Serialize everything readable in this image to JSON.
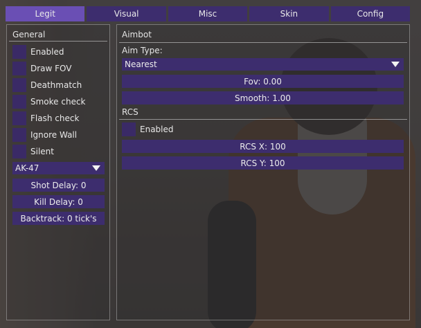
{
  "colors": {
    "tab_active": "#6a4fb4",
    "tab": "#3d2d6e",
    "control": "#3d2d6e",
    "checkbox": "#3a2a66"
  },
  "tabs": [
    {
      "label": "Legit",
      "active": true
    },
    {
      "label": "Visual",
      "active": false
    },
    {
      "label": "Misc",
      "active": false
    },
    {
      "label": "Skin",
      "active": false
    },
    {
      "label": "Config",
      "active": false
    }
  ],
  "general": {
    "title": "General",
    "checkboxes": [
      "Enabled",
      "Draw FOV",
      "Deathmatch",
      "Smoke check",
      "Flash check",
      "Ignore Wall",
      "Silent"
    ],
    "weapon_select": "AK-47",
    "shot_delay": "Shot Delay: 0",
    "kill_delay": "Kill Delay: 0",
    "backtrack": "Backtrack: 0 tick's"
  },
  "aimbot": {
    "title": "Aimbot",
    "aim_type_label": "Aim Type:",
    "aim_type_value": "Nearest",
    "fov": "Fov: 0.00",
    "smooth": "Smooth: 1.00"
  },
  "rcs": {
    "title": "RCS",
    "enabled_label": "Enabled",
    "rcs_x": "RCS X: 100",
    "rcs_y": "RCS Y: 100"
  }
}
